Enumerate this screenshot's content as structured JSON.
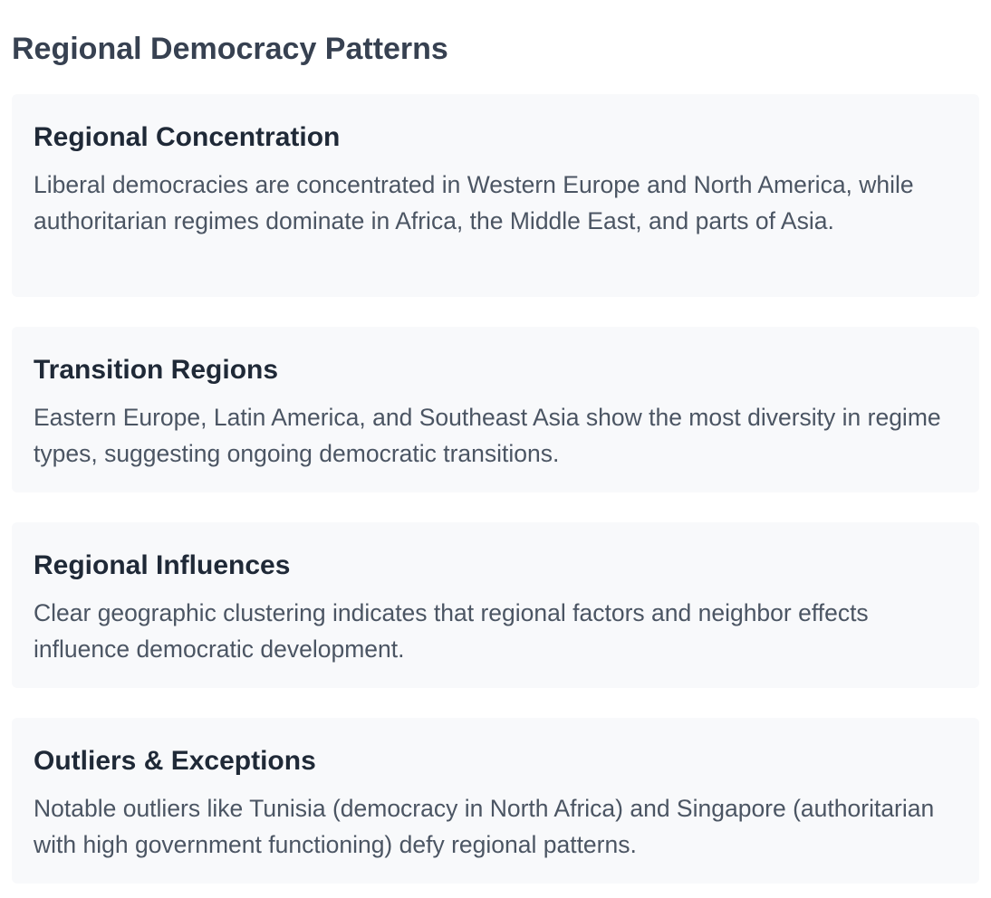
{
  "page": {
    "title": "Regional Democracy Patterns"
  },
  "cards": [
    {
      "title": "Regional Concentration",
      "text": "Liberal democracies are concentrated in Western Europe and North America, while authoritarian regimes dominate in Africa, the Middle East, and parts of Asia."
    },
    {
      "title": "Transition Regions",
      "text": "Eastern Europe, Latin America, and Southeast Asia show the most diversity in regime types, suggesting ongoing democratic transitions."
    },
    {
      "title": "Regional Influences",
      "text": "Clear geographic clustering indicates that regional factors and neighbor effects influence democratic development."
    },
    {
      "title": "Outliers & Exceptions",
      "text": "Notable outliers like Tunisia (democracy in North Africa) and Singapore (authoritarian with high government functioning) defy regional patterns."
    }
  ],
  "colors": {
    "background": "#ffffff",
    "card_background": "#f8f9fb",
    "heading": "#374151",
    "card_title": "#1f2937",
    "body_text": "#4b5563"
  }
}
